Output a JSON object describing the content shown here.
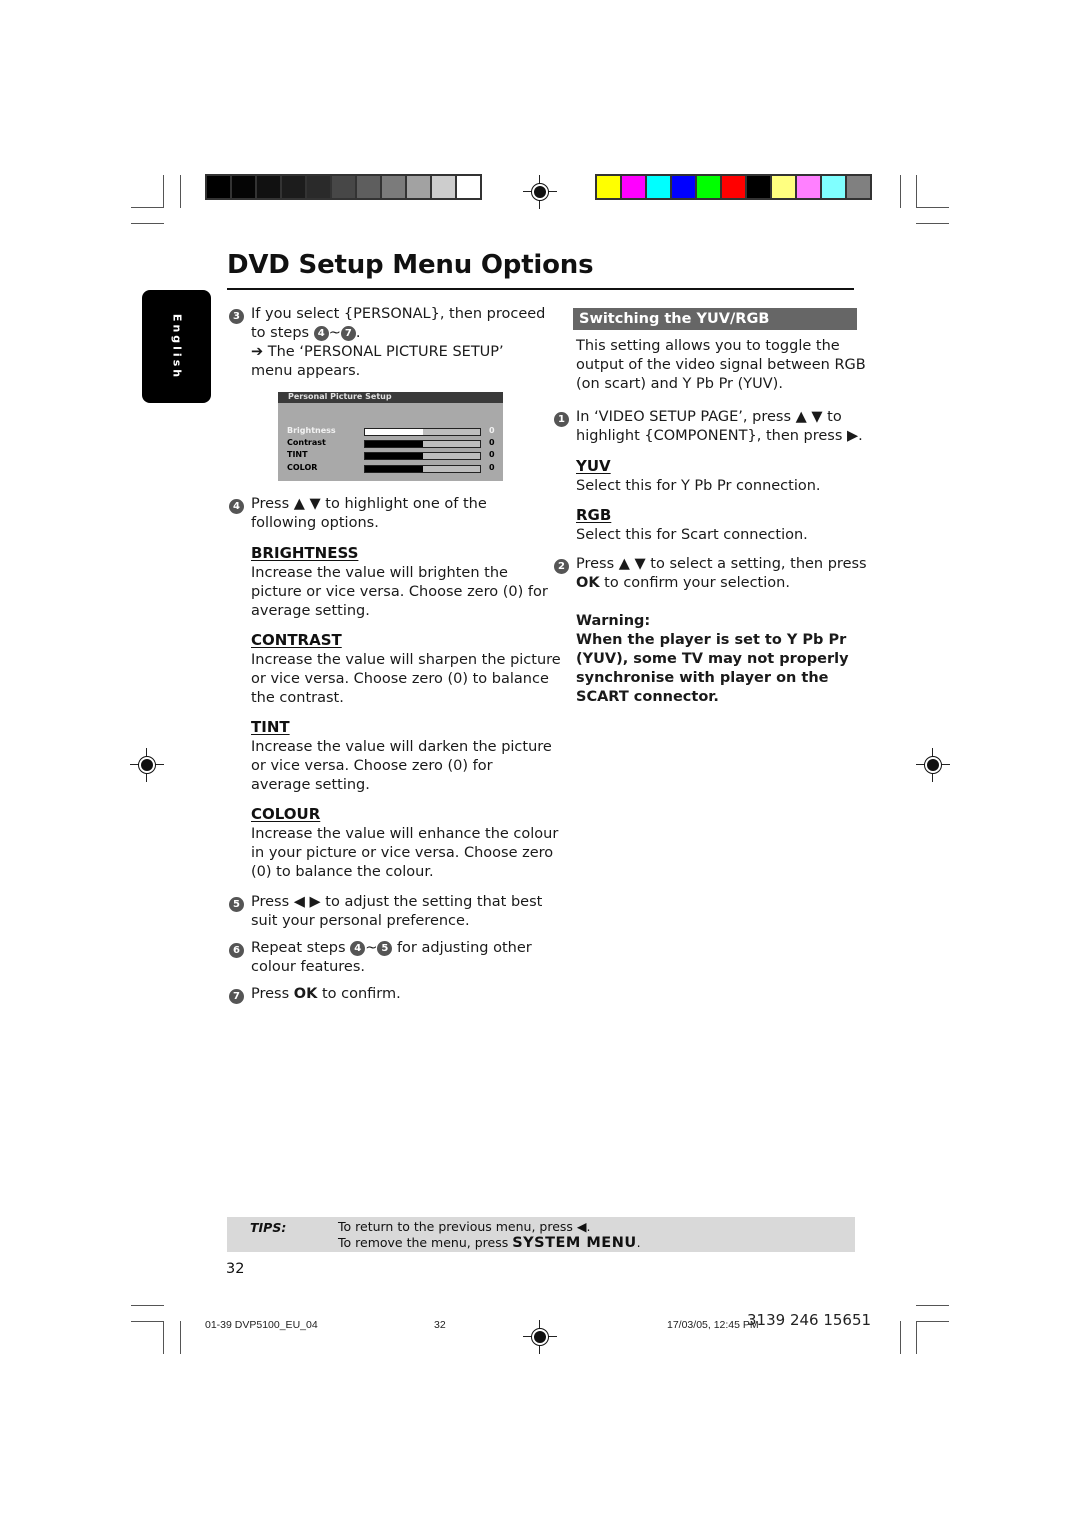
{
  "page": {
    "title": "DVD Setup Menu Options",
    "language_tab": "English",
    "page_number": "32"
  },
  "calibration": {
    "grayscale": [
      "#000000",
      "#050505",
      "#111111",
      "#1c1c1c",
      "#2a2a2a",
      "#474747",
      "#5e5e5e",
      "#7b7b7b",
      "#a2a2a2",
      "#cdcdcd",
      "#ffffff"
    ],
    "colors": [
      "#ffff00",
      "#ff00ff",
      "#00ffff",
      "#0000ff",
      "#00ff00",
      "#ff0000",
      "#000000",
      "#ffff80",
      "#ff80ff",
      "#80ffff",
      "#808080"
    ]
  },
  "left": {
    "step3": {
      "num": "3",
      "line1": "If you select {PERSONAL}, then proceed",
      "line2_pre": "to steps ",
      "ref_a": "4",
      "tilde": "~",
      "ref_b": "7",
      "line2_post": ".",
      "line3": "➔ The ‘PERSONAL PICTURE SETUP’",
      "line4": "menu appears."
    },
    "menu": {
      "title": "Personal Picture Setup",
      "rows": [
        {
          "label": "Brightness",
          "value": "0",
          "fill": 0.5,
          "highlighted": true
        },
        {
          "label": "Contrast",
          "value": "0",
          "fill": 0.5,
          "highlighted": false
        },
        {
          "label": "TINT",
          "value": "0",
          "fill": 0.5,
          "highlighted": false
        },
        {
          "label": "COLOR",
          "value": "0",
          "fill": 0.5,
          "highlighted": false
        }
      ]
    },
    "step4": {
      "num": "4",
      "line1": "Press ▲ ▼ to highlight one of the",
      "line2": "following options."
    },
    "options": [
      {
        "heading": "BRIGHTNESS",
        "lines": [
          "Increase the value will brighten the",
          "picture or vice versa. Choose zero (0) for",
          "average setting."
        ]
      },
      {
        "heading": "CONTRAST",
        "lines": [
          "Increase the value will sharpen the picture",
          "or vice versa.  Choose zero (0) to balance",
          "the contrast."
        ]
      },
      {
        "heading": "TINT",
        "lines": [
          "Increase the value will darken the picture",
          "or vice versa.  Choose zero (0) for",
          "average setting."
        ]
      },
      {
        "heading": "COLOUR",
        "lines": [
          "Increase the value will enhance the colour",
          "in your picture or vice versa. Choose zero",
          "(0) to balance the colour."
        ]
      }
    ],
    "step5": {
      "num": "5",
      "line1": "Press ◀ ▶ to adjust the setting that best",
      "line2": "suit your personal preference."
    },
    "step6": {
      "num": "6",
      "line1_pre": "Repeat steps ",
      "ref_a": "4",
      "tilde": "~",
      "ref_b": "5",
      "line1_post": " for adjusting other",
      "line2": "colour features."
    },
    "step7": {
      "num": "7",
      "pre": "Press ",
      "bold": "OK",
      "post": " to confirm."
    }
  },
  "right": {
    "section_title": "Switching the YUV/RGB",
    "intro": [
      "This setting allows you to toggle the",
      "output of the video signal between RGB",
      "(on scart) and Y Pb Pr (YUV)."
    ],
    "step1": {
      "num": "1",
      "line1": "In ‘VIDEO SETUP PAGE’, press ▲ ▼ to",
      "line2": "highlight {COMPONENT}, then press ▶."
    },
    "yuv": {
      "heading": "YUV",
      "text": "Select this for Y Pb Pr connection."
    },
    "rgb": {
      "heading": "RGB",
      "text": "Select this for Scart connection."
    },
    "step2": {
      "num": "2",
      "line1": "Press ▲ ▼ to select a setting, then press",
      "bold": "OK",
      "line2_post": " to confirm your selection."
    },
    "warning": {
      "label": "Warning:",
      "lines": [
        "When the player is set to Y Pb Pr",
        "(YUV), some TV may not properly",
        "synchronise with player on the",
        "SCART connector."
      ]
    }
  },
  "tips": {
    "label": "TIPS:",
    "line1": "To return to the previous menu, press ◀.",
    "line2_pre": "To remove the menu, press ",
    "line2_bold": "SYSTEM MENU",
    "line2_post": "."
  },
  "footer": {
    "file": "01-39 DVP5100_EU_04",
    "page": "32",
    "datetime": "17/03/05, 12:45 PM",
    "code": "3139 246 15651"
  }
}
